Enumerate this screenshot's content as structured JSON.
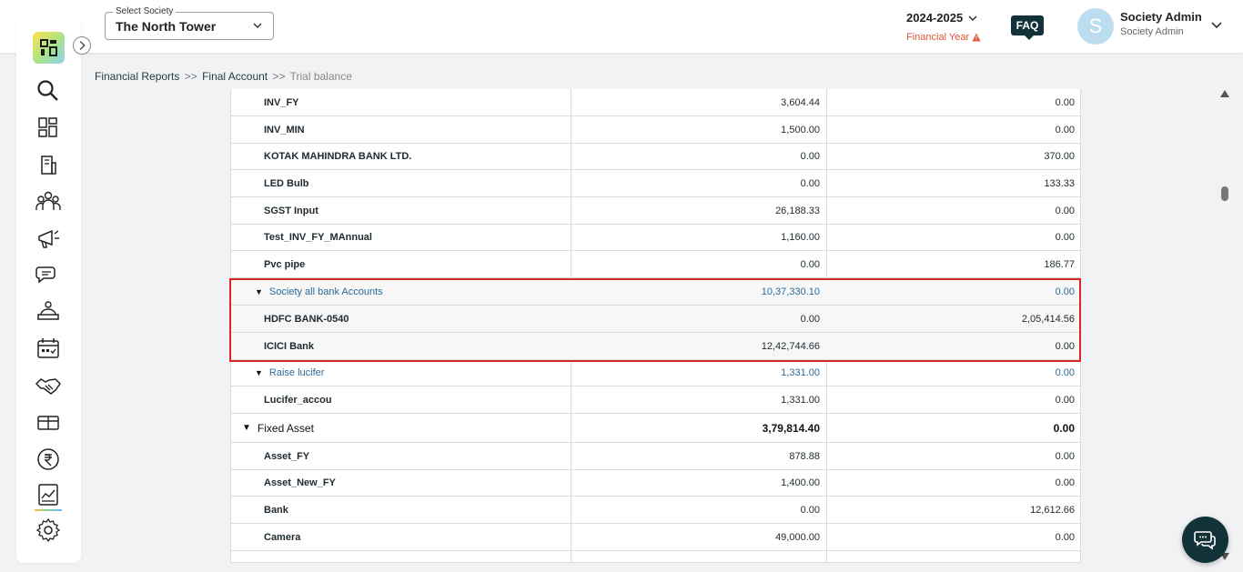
{
  "header": {
    "society_label": "Select Society",
    "society_value": "The North Tower",
    "financial_year": "2024-2025",
    "financial_year_label": "Financial Year",
    "faq_label": "FAQ",
    "avatar_initial": "S",
    "user_name": "Society Admin",
    "user_role": "Society Admin"
  },
  "breadcrumb": {
    "items": [
      "Financial Reports",
      "Final Account",
      "Trial balance"
    ],
    "separator": ">>"
  },
  "sidebar": {
    "icons": [
      "search-icon",
      "dashboard-icon",
      "building-icon",
      "members-icon",
      "announcement-icon",
      "chat-icon",
      "helpdesk-icon",
      "calendar-icon",
      "handshake-icon",
      "parking-icon",
      "rupee-icon",
      "reports-icon",
      "settings-icon"
    ]
  },
  "table": {
    "rows": [
      {
        "name": "INV_FY",
        "debit": "3,604.44",
        "credit": "0.00",
        "kind": "item"
      },
      {
        "name": "INV_MIN",
        "debit": "1,500.00",
        "credit": "0.00",
        "kind": "item"
      },
      {
        "name": "KOTAK MAHINDRA BANK LTD.",
        "debit": "0.00",
        "credit": "370.00",
        "kind": "item"
      },
      {
        "name": "LED Bulb",
        "debit": "0.00",
        "credit": "133.33",
        "kind": "item"
      },
      {
        "name": "SGST Input",
        "debit": "26,188.33",
        "credit": "0.00",
        "kind": "item"
      },
      {
        "name": "Test_INV_FY_MAnnual",
        "debit": "1,160.00",
        "credit": "0.00",
        "kind": "item"
      },
      {
        "name": "Pvc pipe",
        "debit": "0.00",
        "credit": "186.77",
        "kind": "item"
      },
      {
        "name": "Society all bank Accounts",
        "debit": "10,37,330.10",
        "credit": "0.00",
        "kind": "group"
      },
      {
        "name": "HDFC BANK-0540",
        "debit": "0.00",
        "credit": "2,05,414.56",
        "kind": "item"
      },
      {
        "name": "ICICI Bank",
        "debit": "12,42,744.66",
        "credit": "0.00",
        "kind": "item"
      },
      {
        "name": "Raise lucifer",
        "debit": "1,331.00",
        "credit": "0.00",
        "kind": "group"
      },
      {
        "name": "Lucifer_accou",
        "debit": "1,331.00",
        "credit": "0.00",
        "kind": "item"
      },
      {
        "name": "Fixed Asset",
        "debit": "3,79,814.40",
        "credit": "0.00",
        "kind": "top"
      },
      {
        "name": "Asset_FY",
        "debit": "878.88",
        "credit": "0.00",
        "kind": "item"
      },
      {
        "name": "Asset_New_FY",
        "debit": "1,400.00",
        "credit": "0.00",
        "kind": "item"
      },
      {
        "name": "Bank",
        "debit": "0.00",
        "credit": "12,612.66",
        "kind": "item"
      },
      {
        "name": "Camera",
        "debit": "49,000.00",
        "credit": "0.00",
        "kind": "item"
      }
    ]
  },
  "colors": {
    "accent_dark": "#12323a",
    "link_blue": "#2a6a9a",
    "warning": "#e0573a",
    "highlight_border": "#d62828"
  }
}
